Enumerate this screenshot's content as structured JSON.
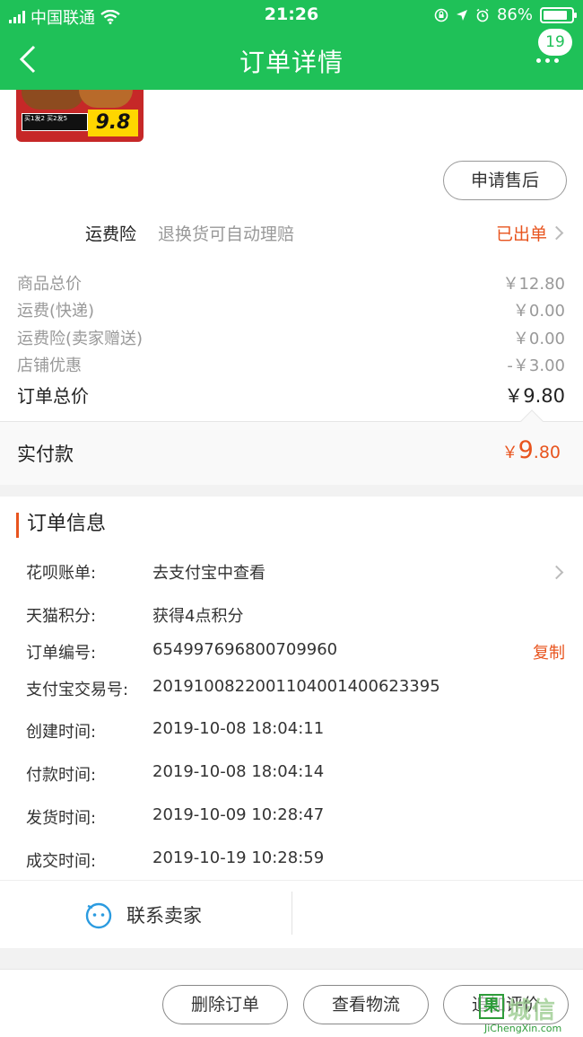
{
  "status_bar": {
    "carrier": "中国联通",
    "time": "21:26",
    "battery": "86%",
    "battery_level": 0.86,
    "icons": [
      "signal-icon",
      "wifi-icon",
      "orientation-lock-icon",
      "location-icon",
      "alarm-icon",
      "battery-icon"
    ]
  },
  "nav": {
    "title": "订单详情",
    "back_icon": "chevron-left-icon",
    "more_icon": "more-dots-icon",
    "badge": "19"
  },
  "product": {
    "thumb_promo": "买1发2 买2发5",
    "thumb_price": "9.8"
  },
  "after_sale_label": "申请售后",
  "insurance": {
    "name": "运费险",
    "desc": "退换货可自动理赔",
    "status": "已出单"
  },
  "price_summary": [
    {
      "label": "商品总价",
      "value": "￥12.80"
    },
    {
      "label": "运费(快递)",
      "value": "￥0.00"
    },
    {
      "label": "运费险(卖家赠送)",
      "value": "￥0.00"
    },
    {
      "label": "店铺优惠",
      "value": "-￥3.00"
    }
  ],
  "order_total": {
    "label": "订单总价",
    "value": "￥9.80"
  },
  "paid": {
    "label": "实付款",
    "currency": "￥",
    "int": "9",
    "dec": ".80"
  },
  "order_info": {
    "title": "订单信息",
    "rows": [
      {
        "key": "花呗账单:",
        "value": "去支付宝中查看"
      },
      {
        "key": "天猫积分:",
        "value": "获得4点积分"
      },
      {
        "key": "订单编号:",
        "value": "654997696800709960"
      },
      {
        "key": "支付宝交易号:",
        "value": "2019100822001104001400623395"
      },
      {
        "key": "创建时间:",
        "value": "2019-10-08 18:04:11"
      },
      {
        "key": "付款时间:",
        "value": "2019-10-08 18:04:14"
      },
      {
        "key": "发货时间:",
        "value": "2019-10-09 10:28:47"
      },
      {
        "key": "成交时间:",
        "value": "2019-10-19 10:28:59"
      }
    ],
    "copy_label": "复制",
    "contact_label": "联系卖家"
  },
  "bottom_actions": {
    "delete": "删除订单",
    "logistics": "查看物流",
    "review": "追加评价"
  },
  "watermark": {
    "char": "果",
    "text": "城信",
    "sub": "JiChengXin.com"
  },
  "colors": {
    "brand_green": "#1fc158",
    "accent_orange": "#e8541e"
  }
}
